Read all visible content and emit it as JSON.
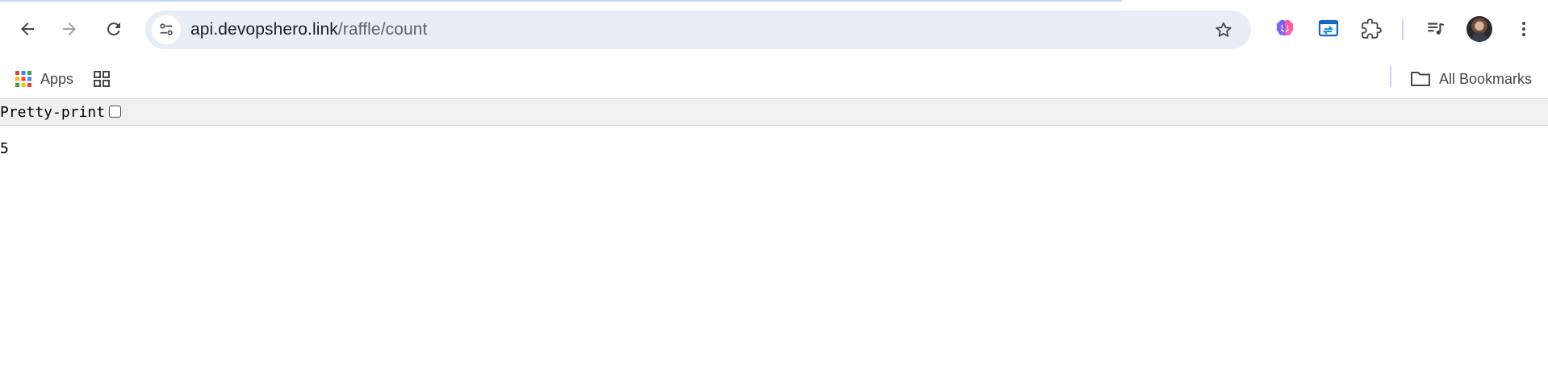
{
  "browser": {
    "url_host": "api.devopshero.link",
    "url_path": "/raffle/count",
    "icons": {
      "back": "back-arrow-icon",
      "forward": "forward-arrow-icon",
      "reload": "reload-icon",
      "site_info": "site-info-icon",
      "bookmark_star": "star-icon",
      "extensions": [
        "brain-extension-icon",
        "screen-extension-icon",
        "puzzle-extensions-icon",
        "media-queue-icon"
      ],
      "menu": "kebab-menu-icon"
    },
    "accent_color": "#e9eef6"
  },
  "bookmarks_bar": {
    "apps_label": "Apps",
    "all_bookmarks_label": "All Bookmarks"
  },
  "page": {
    "pretty_print_label": "Pretty-print",
    "pretty_print_checked": false,
    "value": "5"
  }
}
